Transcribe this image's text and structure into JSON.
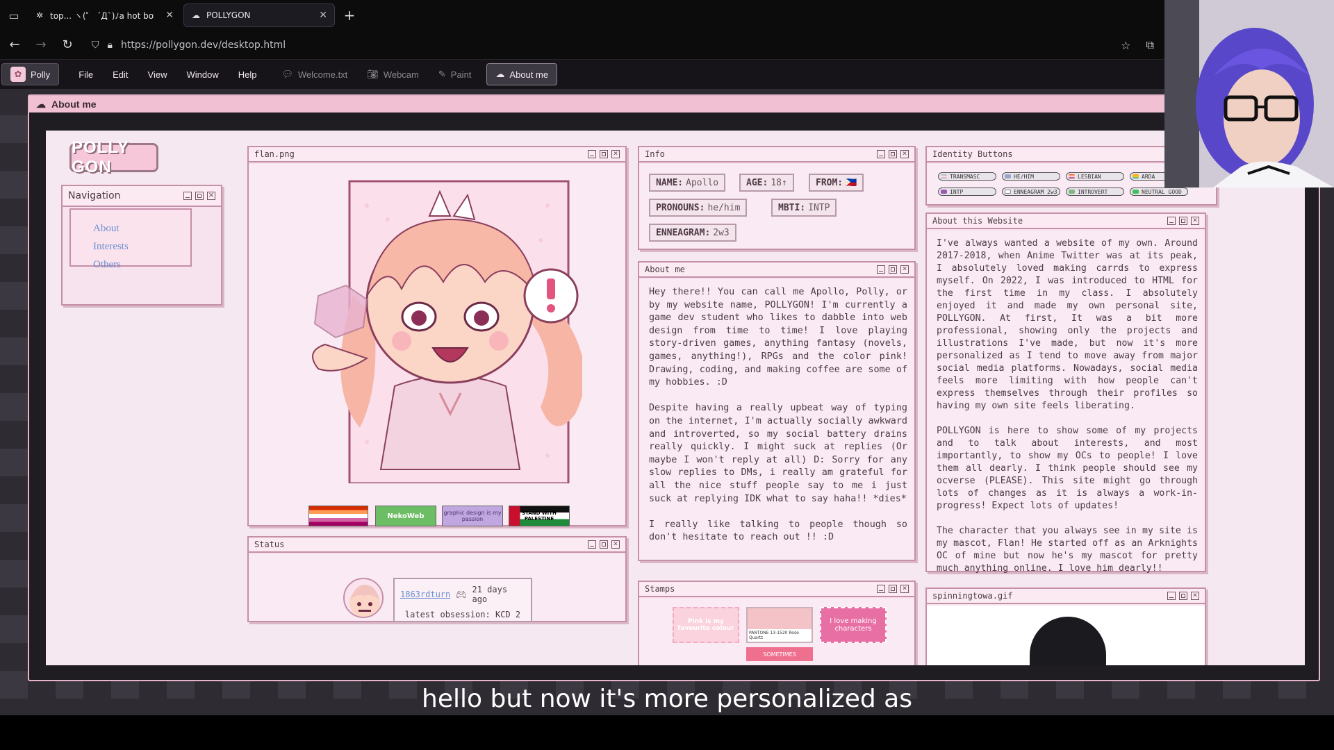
{
  "browser": {
    "tabs": [
      {
        "title": "top... ヽ(゜ ´Д`)ﾉa hot bowl",
        "active": false
      },
      {
        "title": "POLLYGON",
        "active": true
      }
    ],
    "url": "https://pollygon.dev/desktop.html"
  },
  "taskbar": {
    "brand": "Polly",
    "menu": [
      "File",
      "Edit",
      "View",
      "Window",
      "Help"
    ],
    "apps": [
      {
        "label": "Welcome.txt",
        "active": false
      },
      {
        "label": "Webcam",
        "active": false
      },
      {
        "label": "Paint",
        "active": false
      },
      {
        "label": "About me",
        "active": true
      }
    ]
  },
  "window": {
    "title": "About me"
  },
  "logo": "POLLY GON",
  "navigation": {
    "title": "Navigation",
    "links": [
      "About",
      "Interests",
      "Others"
    ]
  },
  "flan": {
    "title": "flan.png",
    "badges": [
      "NekoWeb",
      "graphic design is my passion",
      "STAND WITH PALESTINE"
    ]
  },
  "info": {
    "title": "Info",
    "name_label": "NAME:",
    "name": "Apollo",
    "age_label": "AGE:",
    "age": "18↑",
    "from_label": "FROM:",
    "from": "🇵🇭",
    "pronouns_label": "PRONOUNS:",
    "pronouns": "he/him",
    "mbti_label": "MBTI:",
    "mbti": "INTP",
    "enneagram_label": "ENNEAGRAM:",
    "enneagram": "2w3"
  },
  "about_me": {
    "title": "About me",
    "text": "Hey there!! You can call me Apollo, Polly, or by my website name, POLLYGON! I'm currently a game dev student who likes to dabble into web design from time to time! I love playing story-driven games, anything fantasy (novels, games, anything!), RPGs and the color pink! Drawing, coding, and making coffee are some of my hobbies. :D\n\nDespite having a really upbeat way of typing on the internet, I'm actually socially awkward and introverted, so my social battery drains really quickly. I might suck at replies (Or maybe I won't reply at all) D: Sorry for any slow replies to DMs, i really am grateful for all the nice stuff people say to me i just suck at replying IDK what to say haha!! *dies*\n\nI really like talking to people though so don't hesitate to reach out !! :D"
  },
  "identity": {
    "title": "Identity Buttons",
    "buttons": [
      "TRANSMASC",
      "HE/HIM",
      "LESBIAN",
      "ARDA",
      "INTP",
      "ENNEAGRAM 2w3",
      "INTROVERT",
      "NEUTRAL GOOD"
    ]
  },
  "about_site": {
    "title": "About this Website",
    "text": "I've always wanted a website of my own. Around 2017-2018, when Anime Twitter was at its peak, I absolutely loved making carrds to express myself. On 2022, I was introduced to HTML for the first time in my class. I absolutely enjoyed it and made my own personal site, POLLYGON. At first, It was a bit more professional, showing only the projects and illustrations I've made, but now it's more personalized as I tend to move away from major social media platforms. Nowadays, social media feels more limiting with how people can't express themselves through their profiles so having my own site feels liberating.\n\nPOLLYGON is here to show some of my projects and to talk about interests, and most importantly, to show my OCs to people! I love them all dearly. I think people should see my ocverse (PLEASE). This site might go through lots of changes as it is always a work-in-progress! Expect lots of updates!\n\nThe character that you always see in my site is my mascot, Flan! He started off as an Arknights OC of mine but now he's my mascot for pretty much anything online. I love him dearly!!"
  },
  "status": {
    "title": "Status",
    "user": "1863rdturn",
    "time": "21 days ago",
    "obsession": "latest obsession: KCD 2"
  },
  "stamps": {
    "title": "Stamps",
    "items": [
      "Pink is my favourite colour",
      "PANTONE 13-1520 Rose Quartz",
      "I love making characters",
      "SOMETIMES"
    ]
  },
  "gif": {
    "title": "spinningtowa.gif"
  },
  "subtitle": "hello but now it's more personalized as"
}
